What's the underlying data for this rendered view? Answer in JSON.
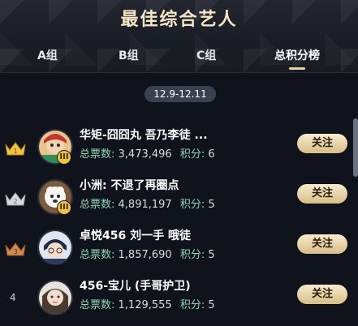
{
  "header": {
    "title": "最佳综合艺人"
  },
  "tabs": [
    {
      "label": "A组"
    },
    {
      "label": "B组"
    },
    {
      "label": "C组"
    },
    {
      "label": "总积分榜"
    }
  ],
  "date_range": "12.9-12.11",
  "list": [
    {
      "rank": "1",
      "name": "华矩-囧囧丸 吾乃李徒 ...",
      "votes_label": "总票数:",
      "votes": "3,473,496",
      "points_label": "积分:",
      "points": "6",
      "follow": "关注",
      "badge": "III"
    },
    {
      "rank": "2",
      "name": "小洲: 不退了再圈点",
      "votes_label": "总票数:",
      "votes": "4,891,197",
      "points_label": "积分:",
      "points": "5",
      "follow": "关注",
      "badge": "III"
    },
    {
      "rank": "3",
      "name": "卓悦456 刘一手 哦徒",
      "votes_label": "总票数:",
      "votes": "1,857,690",
      "points_label": "积分:",
      "points": "5",
      "follow": "关注",
      "badge": ""
    },
    {
      "rank": "4",
      "name": "456-宝儿 (手哥护卫)",
      "votes_label": "总票数:",
      "votes": "1,129,555",
      "points_label": "积分:",
      "points": "5",
      "follow": "关注",
      "badge": ""
    }
  ],
  "colors": {
    "gold_rank": "#f0c24a",
    "silver_rank": "#d8d9df",
    "bronze_rank": "#cf8a4c",
    "follow_bg": "#e2c993",
    "stats_label": "#8fd7b6"
  },
  "icons": {
    "rank_1": "gold-crown-icon",
    "rank_2": "silver-crown-icon",
    "rank_3": "bronze-crown-icon"
  }
}
